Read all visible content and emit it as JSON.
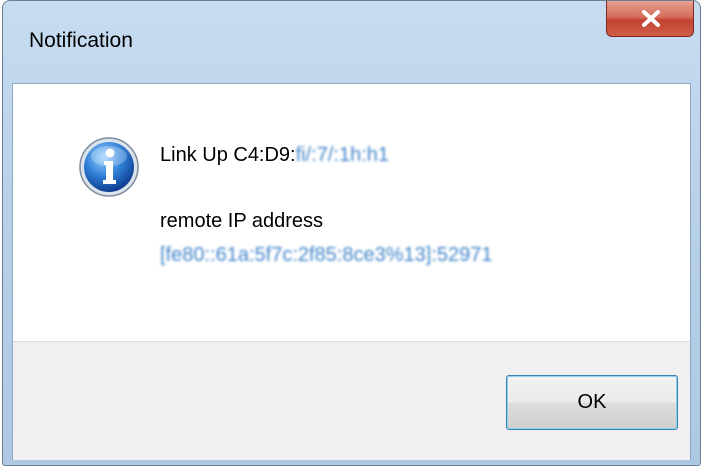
{
  "window": {
    "title": "Notification",
    "close_label": "X"
  },
  "message": {
    "icon": "info-icon",
    "line1_prefix": "Link Up C4:D9:",
    "line1_obscured": "fi/:7/:1h:h1",
    "line2": "remote IP address",
    "line3_obscured": "[fe80::61a:5f7c:2f85:8ce3%13]:52971"
  },
  "buttons": {
    "ok_label": "OK"
  }
}
